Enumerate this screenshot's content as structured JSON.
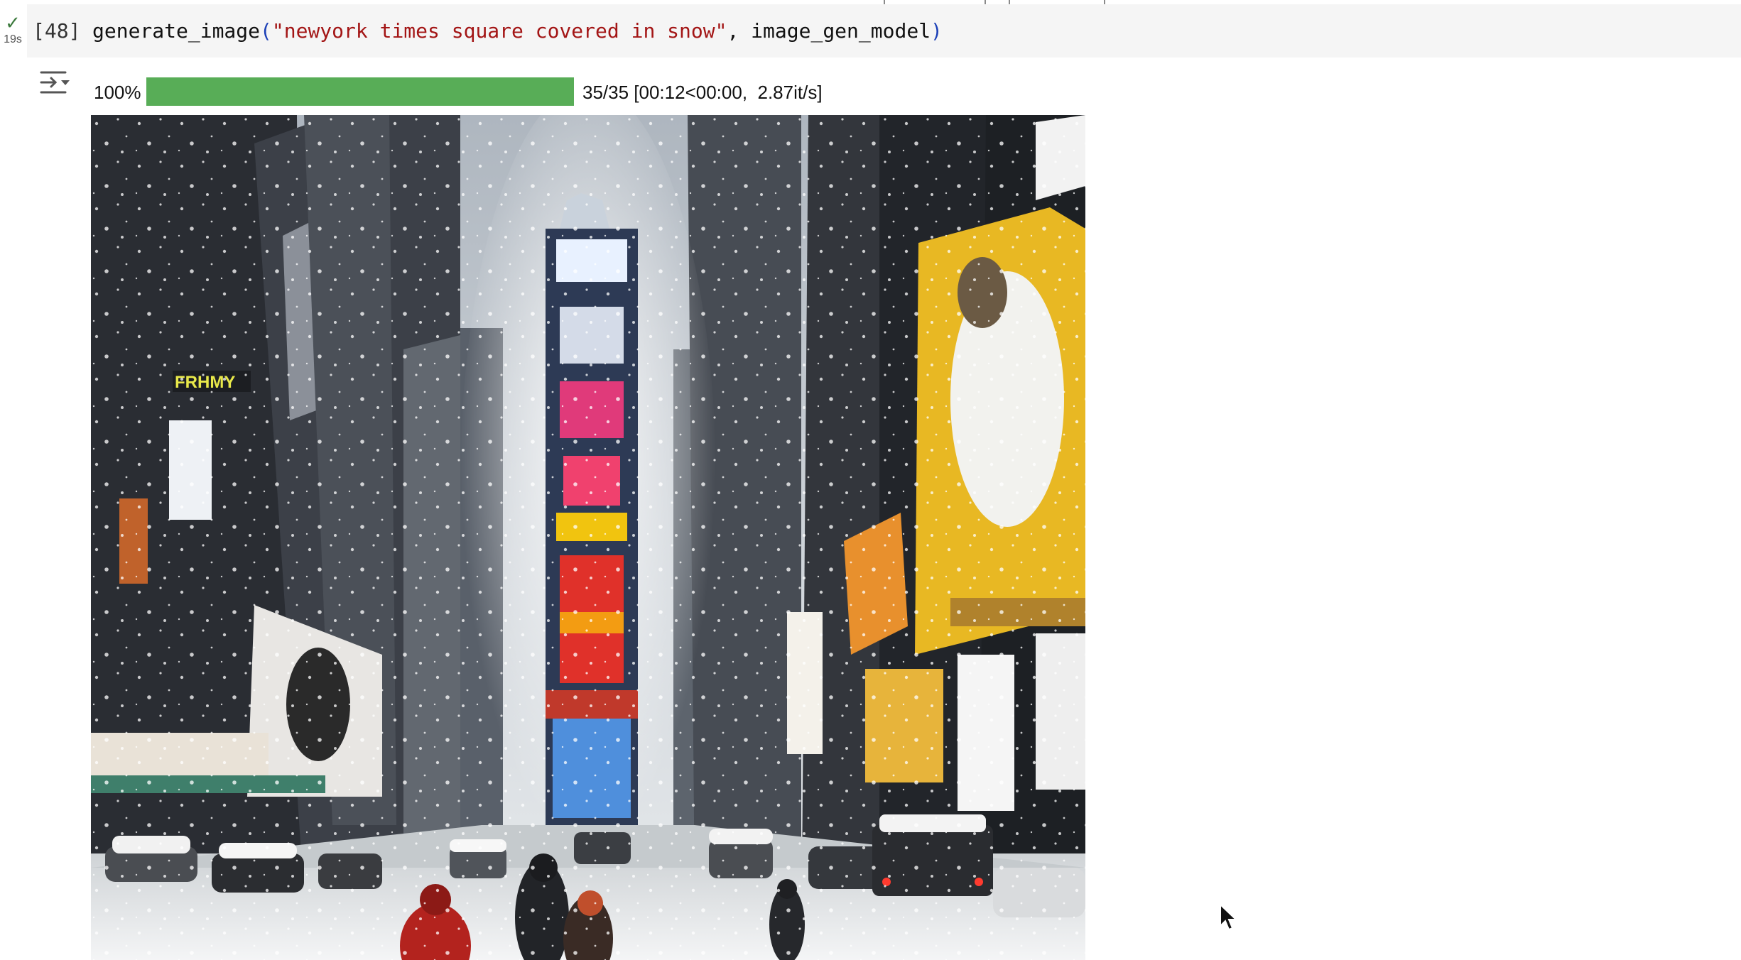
{
  "cell": {
    "status_icon": "check-icon",
    "elapsed": "19s",
    "execution_count": "[48]",
    "code": {
      "func": "generate_image",
      "open_paren": "(",
      "prompt_string": "\"newyork times square covered in snow\"",
      "rest": ", image_gen_model",
      "close_paren": ")"
    }
  },
  "output": {
    "toggle_icon": "output-collapse-icon",
    "progress": {
      "percent_label": "100%",
      "fraction": 1.0,
      "stats": "35/35 [00:12<00:00,  2.87it/s]",
      "color": "#58ad57"
    },
    "image_icon": "generated-image-snowy-times-square"
  },
  "colors": {
    "code_bg": "#f5f5f5",
    "string": "#a31515",
    "paren": "#1d41b7",
    "success": "#3d7b3e"
  }
}
